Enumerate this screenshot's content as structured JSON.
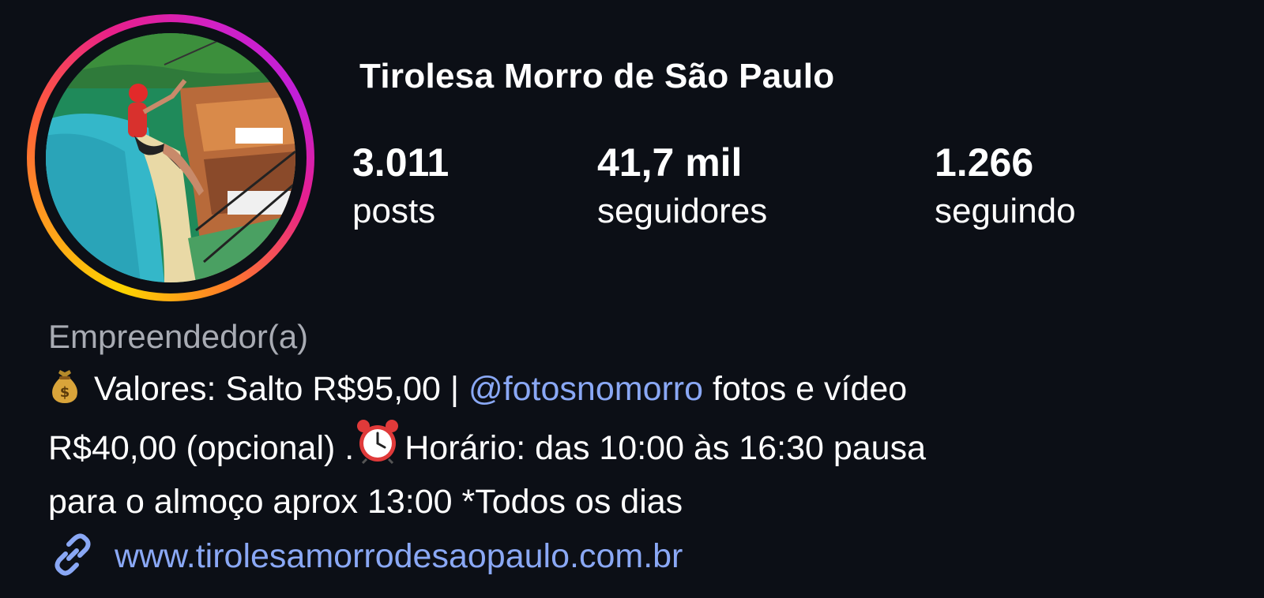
{
  "profile": {
    "name": "Tirolesa Morro de São Paulo",
    "avatar_alt": "zipline rider over beach"
  },
  "stats": [
    {
      "count": "3.011",
      "label": "posts"
    },
    {
      "count": "41,7 mil",
      "label": "seguidores"
    },
    {
      "count": "1.266",
      "label": "seguindo"
    }
  ],
  "bio": {
    "category": "Empreendedor(a)",
    "line1_prefix": " Valores: Salto R$95,00 | ",
    "mention": "@fotosnomorro",
    "line1_suffix": " fotos e vídeo",
    "line2_prefix": "R$40,00 (opcional) .",
    "line2_suffix": "Horário: das 10:00 às 16:30  pausa",
    "line3": "para o almoço aprox 13:00 *Todos os dias",
    "icons": [
      "money-bag-icon",
      "alarm-clock-icon"
    ]
  },
  "link": {
    "icon": "link-icon",
    "url": "www.tirolesamorrodesaopaulo.com.br"
  },
  "colors": {
    "background": "#0c0f16",
    "link": "#8aa8f5",
    "category": "#a8abb3"
  }
}
